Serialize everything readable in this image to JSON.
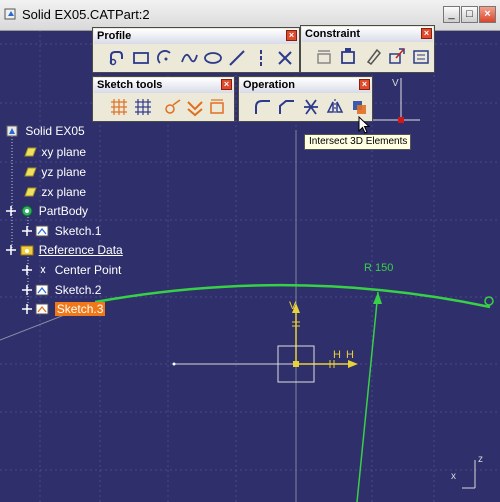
{
  "window": {
    "title": "Solid EX05.CATPart:2",
    "buttons": [
      "_",
      "□",
      "×"
    ]
  },
  "toolbars": {
    "profile": {
      "title": "Profile",
      "icons": [
        "profile-icon",
        "rectangle-icon",
        "circle-icon",
        "spline-icon",
        "ellipse-icon",
        "line-icon",
        "axis-icon",
        "point-icon"
      ]
    },
    "constraint": {
      "title": "Constraint",
      "icons": [
        "constraint-icon",
        "fix-together-icon",
        "auto-constraint-icon",
        "animate-constraint-icon",
        "edit-multi-constraint-icon"
      ]
    },
    "sketch_tools": {
      "title": "Sketch tools",
      "icons": [
        "grid-icon",
        "snap-to-point-icon",
        "construction-element-icon",
        "geometrical-constraints-icon",
        "dimensional-constraints-icon"
      ]
    },
    "operation": {
      "title": "Operation",
      "icons": [
        "corner-icon",
        "chamfer-icon",
        "trim-icon",
        "mirror-icon",
        "intersect-3d-elements-icon"
      ]
    }
  },
  "tooltip": {
    "text": "Intersect 3D Elements"
  },
  "tree": {
    "items": [
      {
        "name": "root",
        "label": "Solid EX05"
      },
      {
        "name": "xy-plane",
        "label": "xy plane"
      },
      {
        "name": "yz-plane",
        "label": "yz plane"
      },
      {
        "name": "zx-plane",
        "label": "zx plane"
      },
      {
        "name": "partbody",
        "label": "PartBody"
      },
      {
        "name": "sketch-1",
        "label": "Sketch.1"
      },
      {
        "name": "reference-data",
        "label": "Reference Data"
      },
      {
        "name": "center-point",
        "label": "Center Point"
      },
      {
        "name": "sketch-2",
        "label": "Sketch.2"
      },
      {
        "name": "sketch-3",
        "label": "Sketch.3"
      }
    ]
  },
  "canvas": {
    "radius_label": "R 150",
    "h_label": "H",
    "h_label_2": "H",
    "v_label": "V",
    "corner_v": "V",
    "compass_x": "x",
    "compass_z": "z"
  },
  "colors": {
    "background": "#2f2f6c",
    "grid": "#4a4a8a",
    "arc": "#38d046",
    "axis": "#e8d23a",
    "selection": "#f07818"
  }
}
